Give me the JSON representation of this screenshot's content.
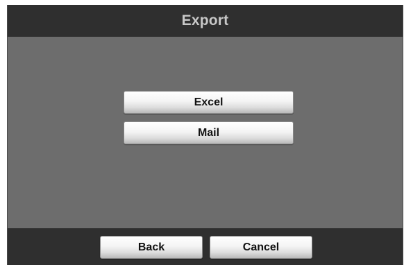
{
  "dialog": {
    "title": "Export"
  },
  "options": {
    "excel_label": "Excel",
    "mail_label": "Mail"
  },
  "footer": {
    "back_label": "Back",
    "cancel_label": "Cancel"
  }
}
